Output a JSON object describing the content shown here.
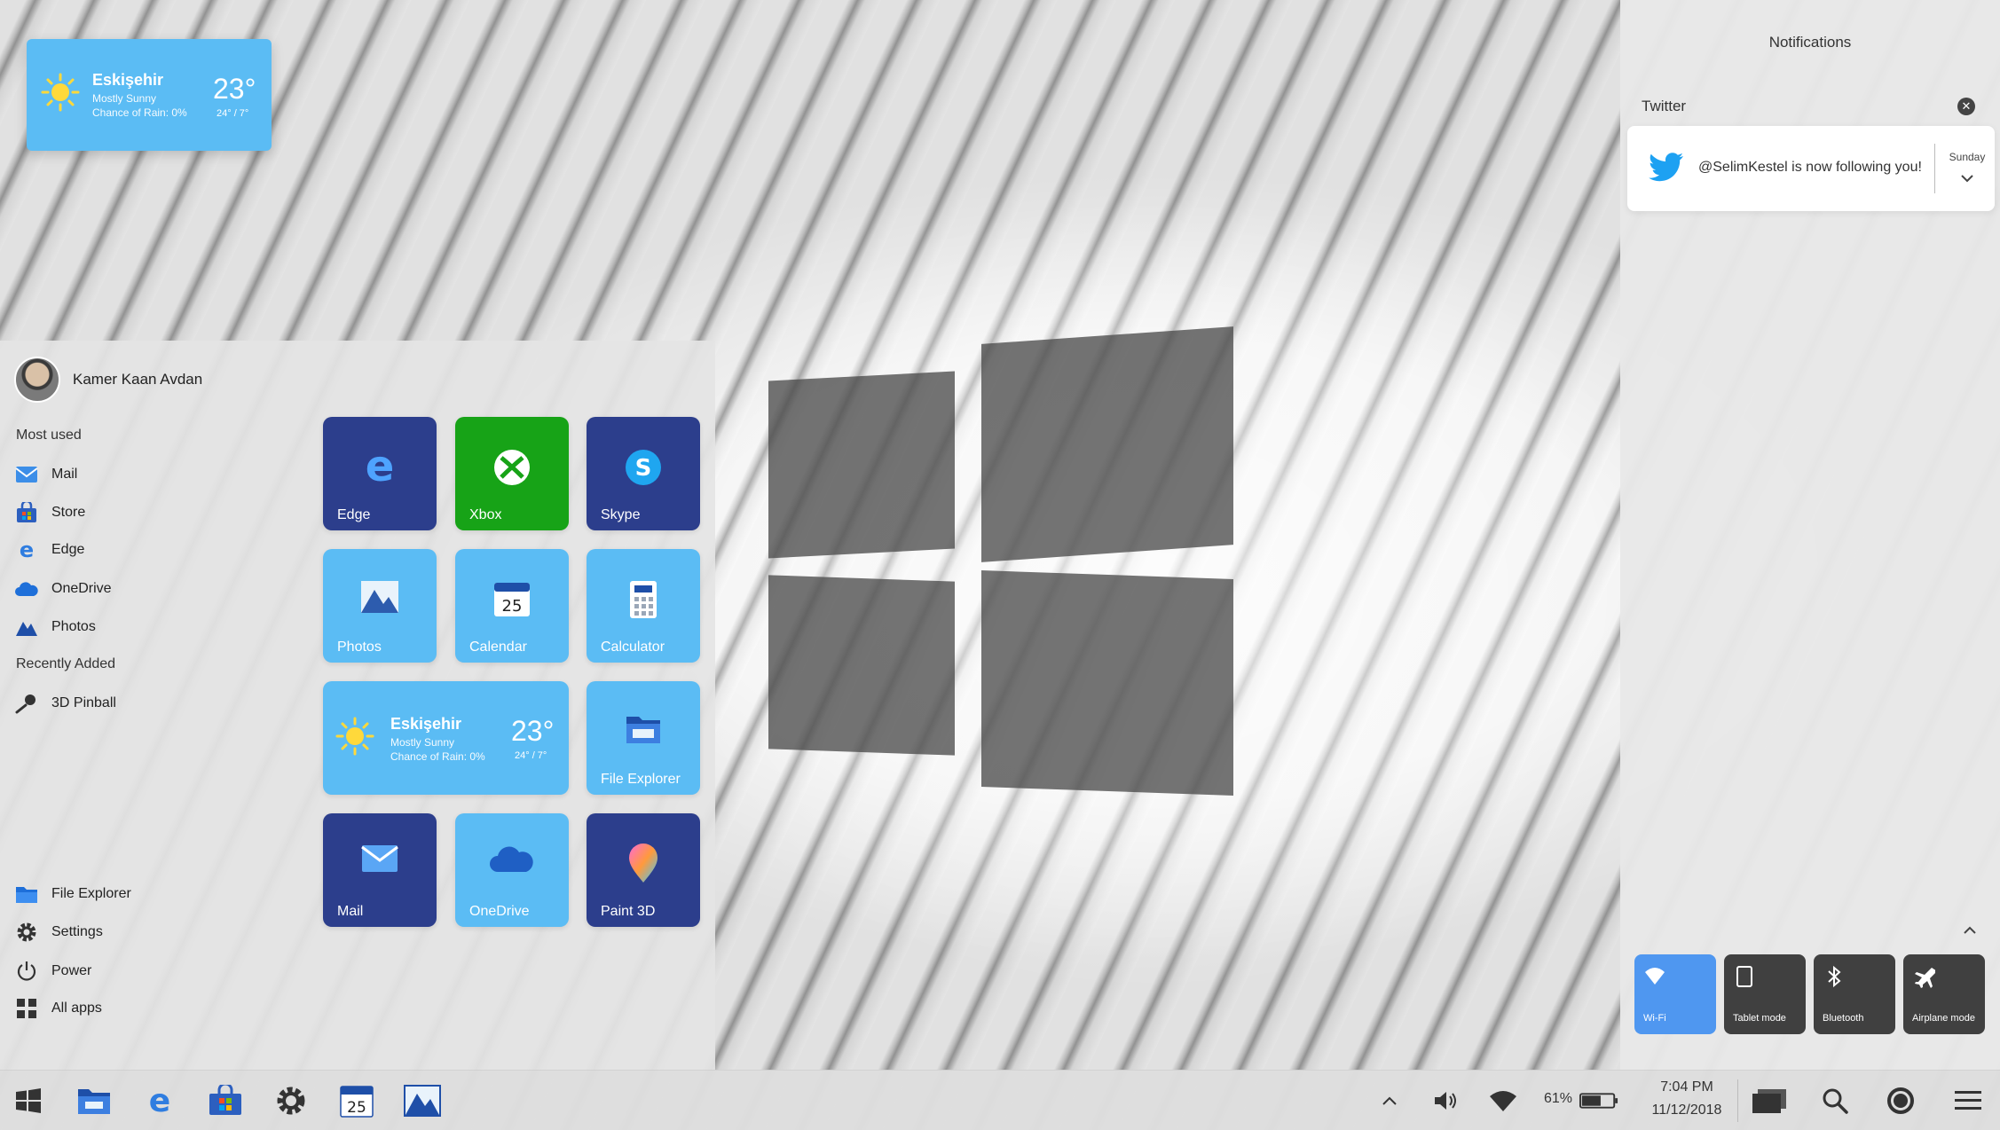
{
  "desktop_weather": {
    "city": "Eskişehir",
    "condition": "Mostly Sunny",
    "rain": "Chance of Rain: 0%",
    "temp": "23°",
    "range": "24° / 7°",
    "icon": "sun-icon"
  },
  "start_menu": {
    "user_name": "Kamer Kaan Avdan",
    "most_used_label": "Most used",
    "most_used": [
      {
        "label": "Mail",
        "icon": "mail-icon"
      },
      {
        "label": "Store",
        "icon": "store-icon"
      },
      {
        "label": "Edge",
        "icon": "edge-icon"
      },
      {
        "label": "OneDrive",
        "icon": "onedrive-icon"
      },
      {
        "label": "Photos",
        "icon": "photos-icon"
      }
    ],
    "recently_added_label": "Recently Added",
    "recently_added": [
      {
        "label": "3D Pinball",
        "icon": "pinball-icon"
      }
    ],
    "bottom_items": [
      {
        "label": "File Explorer",
        "icon": "folder-icon"
      },
      {
        "label": "Settings",
        "icon": "gear-icon"
      },
      {
        "label": "Power",
        "icon": "power-icon"
      },
      {
        "label": "All apps",
        "icon": "grid-icon"
      }
    ],
    "tiles": {
      "edge": "Edge",
      "xbox": "Xbox",
      "skype": "Skype",
      "photos": "Photos",
      "calendar": "Calendar",
      "calendar_day": "25",
      "calculator": "Calculator",
      "file_explorer": "File Explorer",
      "mail": "Mail",
      "onedrive": "OneDrive",
      "paint3d": "Paint 3D",
      "weather": {
        "city": "Eskişehir",
        "condition": "Mostly Sunny",
        "rain": "Chance of Rain: 0%",
        "temp": "23°",
        "range": "24° / 7°"
      }
    }
  },
  "notifications": {
    "title": "Notifications",
    "group": "Twitter",
    "card": {
      "text": "@SelimKestel is now following you!",
      "day": "Sunday",
      "icon": "twitter-icon"
    },
    "quick_actions": [
      {
        "label": "Wi-Fi",
        "icon": "wifi-icon",
        "active": true
      },
      {
        "label": "Tablet mode",
        "icon": "tablet-icon",
        "active": false
      },
      {
        "label": "Bluetooth",
        "icon": "bluetooth-icon",
        "active": false
      },
      {
        "label": "Airplane mode",
        "icon": "airplane-icon",
        "active": false
      }
    ]
  },
  "taskbar": {
    "calendar_day": "25",
    "battery": "61%",
    "time": "7:04 PM",
    "date": "11/12/2018"
  },
  "colors": {
    "tile_dark": "#2c3e8c",
    "tile_light": "#5bbcf4",
    "xbox_green": "#17a317",
    "accent": "#4f97f0"
  }
}
